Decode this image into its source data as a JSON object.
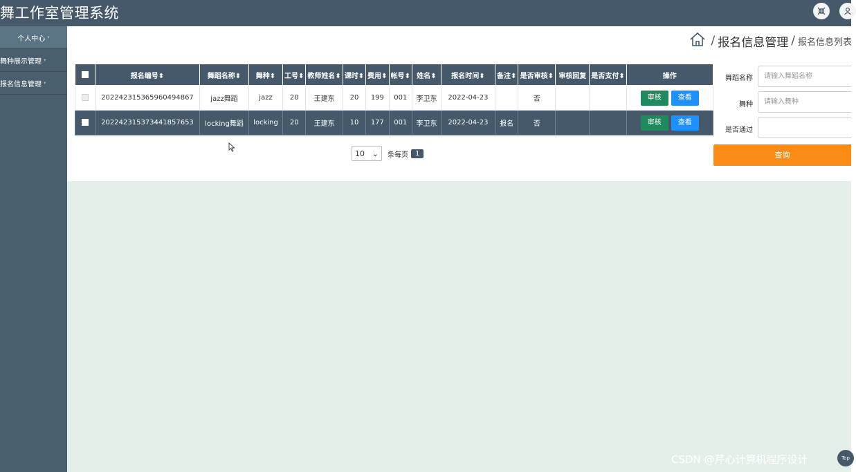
{
  "app": {
    "title": "舞工作室管理系统"
  },
  "topbar": {
    "fullscreen_icon": "fullscreen-exit-icon",
    "user_icon": "user-icon"
  },
  "sidebar": {
    "items": [
      {
        "label": "个人中心"
      },
      {
        "label": "舞种展示管理"
      },
      {
        "label": "报名信息管理"
      }
    ]
  },
  "breadcrumb": {
    "separator": "/",
    "main": "报名信息管理",
    "sub": "报名信息列表"
  },
  "table": {
    "headers": [
      "报名编号",
      "舞蹈名称",
      "舞种",
      "工号",
      "教师姓名",
      "课时",
      "费用",
      "帐号",
      "姓名",
      "报名时间",
      "备注",
      "是否审核",
      "审核回复",
      "是否支付",
      "操作"
    ],
    "sortable": [
      true,
      true,
      true,
      true,
      true,
      true,
      true,
      true,
      true,
      true,
      true,
      true,
      false,
      true,
      false
    ],
    "rows": [
      {
        "id": "202242315365960494867",
        "dance": "jazz舞蹈",
        "type": "jazz",
        "job_no": "20",
        "teacher": "王建东",
        "hours": "20",
        "fee": "199",
        "account": "001",
        "name": "李卫东",
        "date": "2022-04-23",
        "remark": "",
        "audited": "否",
        "reply": "",
        "paid": ""
      },
      {
        "id": "202242315373441857653",
        "dance": "locking舞蹈",
        "type": "locking",
        "job_no": "20",
        "teacher": "王建东",
        "hours": "10",
        "fee": "177",
        "account": "001",
        "name": "李卫东",
        "date": "2022-04-23",
        "remark": "报名",
        "audited": "否",
        "reply": "",
        "paid": ""
      }
    ],
    "audit_label": "审核",
    "view_label": "查看"
  },
  "pager": {
    "page_size": "10",
    "per_page_label": "条每页",
    "current_page": "1"
  },
  "search": {
    "dance_label": "舞蹈名称",
    "dance_placeholder": "请输入舞蹈名称",
    "type_label": "舞种",
    "type_placeholder": "请输入舞种",
    "pass_label": "是否通过",
    "pass_value": "",
    "query_label": "查询"
  },
  "watermark": "CSDN @芹心计算机程序设计",
  "back_to_top": "Top",
  "colors": {
    "header": "#46596a",
    "sidebar": "#4a5f6e",
    "audit": "#1f8a5e",
    "view": "#1e90ff",
    "query": "#fa8c16",
    "content_bg": "#e5efea"
  }
}
